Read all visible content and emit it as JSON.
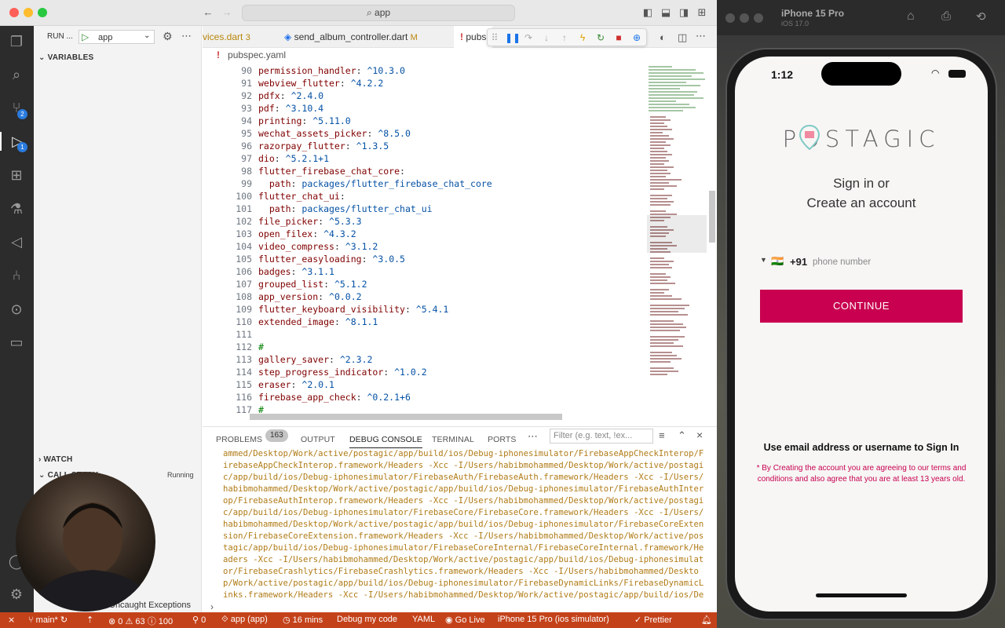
{
  "titlebar": {
    "search": "app"
  },
  "run": {
    "label": "RUN ...",
    "config": "app"
  },
  "sidebar": {
    "variables": "VARIABLES",
    "watch": "WATCH",
    "callstack": "CALL STACK",
    "callstack_status": "Running",
    "breakpoint": "Uncaught Exceptions"
  },
  "activity_badges": {
    "scm": "2",
    "debug": "1"
  },
  "tabs": [
    {
      "label": "vices.dart",
      "badge": "3"
    },
    {
      "label": "send_album_controller.dart",
      "badge": "M"
    },
    {
      "label": "pubs"
    }
  ],
  "breadcrumb": "pubspec.yaml",
  "code": [
    {
      "n": "90",
      "k": "permission_handler",
      "v": "^10.3.0"
    },
    {
      "n": "91",
      "k": "webview_flutter",
      "v": "^4.2.2"
    },
    {
      "n": "92",
      "k": "pdfx",
      "v": "^2.4.0"
    },
    {
      "n": "93",
      "k": "pdf",
      "v": "^3.10.4"
    },
    {
      "n": "94",
      "k": "printing",
      "v": "^5.11.0"
    },
    {
      "n": "95",
      "k": "wechat_assets_picker",
      "v": "^8.5.0"
    },
    {
      "n": "96",
      "k": "razorpay_flutter",
      "v": "^1.3.5"
    },
    {
      "n": "97",
      "k": "dio",
      "v": "^5.2.1+1"
    },
    {
      "n": "98",
      "k": "flutter_firebase_chat_core",
      "v": ""
    },
    {
      "n": "99",
      "k": "  path",
      "v": "packages/flutter_firebase_chat_core"
    },
    {
      "n": "100",
      "k": "flutter_chat_ui",
      "v": ""
    },
    {
      "n": "101",
      "k": "  path",
      "v": "packages/flutter_chat_ui"
    },
    {
      "n": "102",
      "k": "file_picker",
      "v": "^5.3.3"
    },
    {
      "n": "103",
      "k": "open_filex",
      "v": "^4.3.2"
    },
    {
      "n": "104",
      "k": "video_compress",
      "v": "^3.1.2"
    },
    {
      "n": "105",
      "k": "flutter_easyloading",
      "v": "^3.0.5"
    },
    {
      "n": "106",
      "k": "badges",
      "v": "^3.1.1"
    },
    {
      "n": "107",
      "k": "grouped_list",
      "v": "^5.1.2"
    },
    {
      "n": "108",
      "k": "app_version",
      "v": "^0.0.2"
    },
    {
      "n": "109",
      "k": "flutter_keyboard_visibility",
      "v": "^5.4.1"
    },
    {
      "n": "110",
      "k": "extended_image",
      "v": "^8.1.1"
    },
    {
      "n": "111",
      "k": "",
      "v": ""
    },
    {
      "n": "112",
      "k": "#",
      "v": "",
      "comment": true
    },
    {
      "n": "113",
      "k": "gallery_saver",
      "v": "^2.3.2"
    },
    {
      "n": "114",
      "k": "step_progress_indicator",
      "v": "^1.0.2"
    },
    {
      "n": "115",
      "k": "eraser",
      "v": "^2.0.1"
    },
    {
      "n": "116",
      "k": "firebase_app_check",
      "v": "^0.2.1+6"
    },
    {
      "n": "117",
      "k": "#",
      "v": "",
      "comment": true
    }
  ],
  "panel": {
    "tabs": [
      "PROBLEMS",
      "OUTPUT",
      "DEBUG CONSOLE",
      "TERMINAL",
      "PORTS"
    ],
    "problems_count": "163",
    "filter_placeholder": "Filter (e.g. text, !ex...",
    "console": "ammed/Desktop/Work/active/postagic/app/build/ios/Debug-iphonesimulator/FirebaseAppCheckInterop/FirebaseAppCheckInterop.framework/Headers -Xcc -I/Users/habibmohammed/Desktop/Work/active/postagic/app/build/ios/Debug-iphonesimulator/FirebaseAuth/FirebaseAuth.framework/Headers -Xcc -I/Users/habibmohammed/Desktop/Work/active/postagic/app/build/ios/Debug-iphonesimulator/FirebaseAuthInterop/FirebaseAuthInterop.framework/Headers -Xcc -I/Users/habibmohammed/Desktop/Work/active/postagic/app/build/ios/Debug-iphonesimulator/FirebaseCore/FirebaseCore.framework/Headers -Xcc -I/Users/habibmohammed/Desktop/Work/active/postagic/app/build/ios/Debug-iphonesimulator/FirebaseCoreExtension/FirebaseCoreExtension.framework/Headers -Xcc -I/Users/habibmohammed/Desktop/Work/active/postagic/app/build/ios/Debug-iphonesimulator/FirebaseCoreInternal/FirebaseCoreInternal.framework/Headers -Xcc -I/Users/habibmohammed/Desktop/Work/active/postagic/app/build/ios/Debug-iphonesimulator/FirebaseCrashlytics/FirebaseCrashlytics.framework/Headers -Xcc -I/Users/habibmohammed/Desktop/Work/active/postagic/app/build/ios/Debug-iphonesimulator/FirebaseDynamicLinks/FirebaseDynamicLinks.framework/Headers -Xcc -I/Users/habibmohammed/Desktop/Work/active/postagic/app/build/ios/De"
  },
  "status": {
    "branch": "main*",
    "errors": "0",
    "warnings": "63",
    "infos": "100",
    "ports": "0",
    "target": "app (app)",
    "timer": "16 mins",
    "debug": "Debug my code",
    "lang": "YAML",
    "golive": "Go Live",
    "device": "iPhone 15 Pro (ios simulator)",
    "prettier": "Prettier"
  },
  "simulator": {
    "device": "iPhone 15 Pro",
    "os": "iOS 17.0"
  },
  "phone": {
    "time": "1:12",
    "logo": "POSTAGIC",
    "title1": "Sign in or",
    "title2": "Create an account",
    "country_code": "+91",
    "flag": "🇮🇳",
    "phone_placeholder": "phone number",
    "continue": "CONTINUE",
    "alt_signin": "Use email address or username to Sign In",
    "terms": "* By Creating the account you are agreeing to our terms and conditions and also agree that you are at least 13 years old.",
    "accent": "#c8004f"
  }
}
